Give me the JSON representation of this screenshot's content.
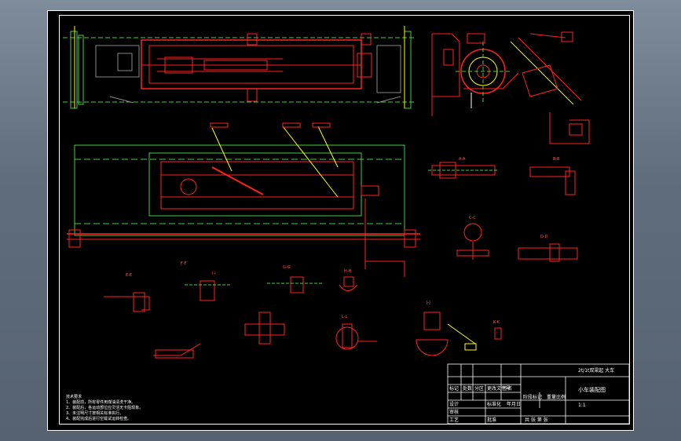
{
  "title_block": {
    "project": "2t/1t双梁起 大车",
    "drawing_name": "小车装配图",
    "labels": {
      "designed": "设计",
      "checked": "审核",
      "approved": "批准",
      "scale_head": "比例",
      "mass_head": "重量",
      "stage_mark": "阶段标记",
      "sheets": "共 张 第 张",
      "scale": "1:1",
      "marks": "标记",
      "count": "处数",
      "zone": "分区",
      "change_doc": "更改文件号",
      "signature": "签名",
      "date": "年月日",
      "standard": "标准化",
      "craft": "工艺"
    }
  },
  "notes": {
    "heading": "技术要求",
    "lines": [
      "1、装配前，所有零件用煤油清洗干净。",
      "2、装配后，各运动部位应灵活无卡阻现象。",
      "3、未注明尺寸按相关标准执行。",
      "4、装配完成后进行空载试运转检查。"
    ]
  },
  "section_labels": [
    "A-A",
    "B-B",
    "C-C",
    "D-D",
    "E-E",
    "F-F",
    "G-G",
    "H-H",
    "I-I",
    "J-J",
    "K-K",
    "L-L"
  ]
}
